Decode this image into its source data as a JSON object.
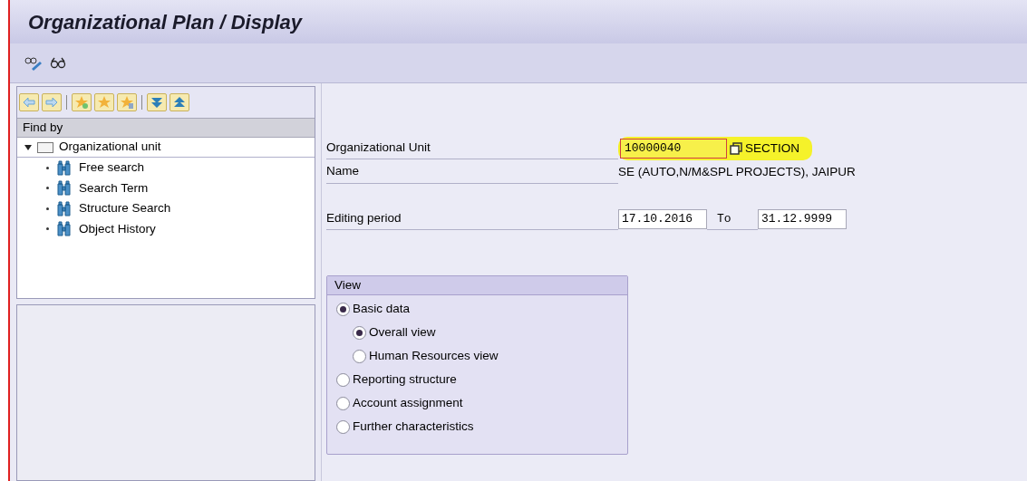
{
  "window": {
    "title": "Organizational Plan / Display"
  },
  "find_by": {
    "header": "Find by",
    "root": {
      "label": "Organizational unit",
      "expanded": true,
      "children": [
        {
          "label": "Free search"
        },
        {
          "label": "Search Term"
        },
        {
          "label": "Structure Search"
        },
        {
          "label": "Object History"
        }
      ]
    }
  },
  "form": {
    "org_unit": {
      "label": "Organizational Unit",
      "value": "10000040",
      "type_text": "SECTION"
    },
    "name": {
      "label": "Name",
      "value": "SE (AUTO,N/M&SPL PROJECTS), JAIPUR"
    },
    "period": {
      "label": "Editing period",
      "from": "17.10.2016",
      "to_label": "To",
      "to": "31.12.9999"
    }
  },
  "view": {
    "title": "View",
    "options": [
      {
        "label": "Basic data",
        "selected": true,
        "children": [
          {
            "label": "Overall view",
            "selected": true
          },
          {
            "label": "Human Resources view",
            "selected": false
          }
        ]
      },
      {
        "label": "Reporting structure",
        "selected": false
      },
      {
        "label": "Account assignment",
        "selected": false
      },
      {
        "label": "Further characteristics",
        "selected": false
      }
    ]
  }
}
